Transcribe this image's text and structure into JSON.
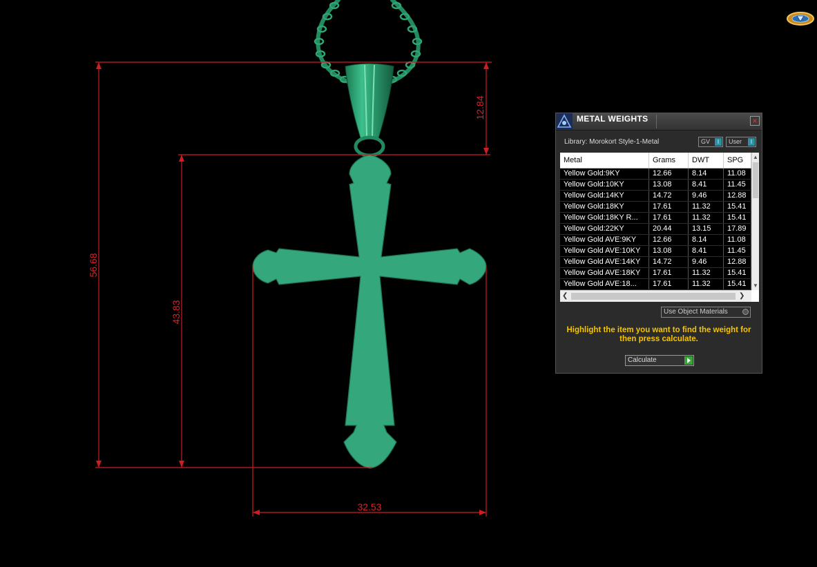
{
  "dimensions": {
    "overall_height": "56.68",
    "cross_height": "43.83",
    "bail_height": "12.84",
    "cross_width": "32.53"
  },
  "colors": {
    "metal_green": "#34a77c",
    "dimension_red": "#e0202a",
    "hint_yellow": "#f5c400"
  },
  "panel": {
    "title": "METAL WEIGHTS",
    "close_label": "×",
    "library_label": "Library: Morokort Style-1-Metal",
    "gv_label": "GV",
    "gv_indicator": "I",
    "user_label": "User",
    "user_indicator": "I",
    "table": {
      "headers": [
        "Metal",
        "Grams",
        "DWT",
        "SPG"
      ],
      "rows": [
        [
          "Yellow Gold:9KY",
          "12.66",
          "8.14",
          "11.08"
        ],
        [
          "Yellow Gold:10KY",
          "13.08",
          "8.41",
          "11.45"
        ],
        [
          "Yellow Gold:14KY",
          "14.72",
          "9.46",
          "12.88"
        ],
        [
          "Yellow Gold:18KY",
          "17.61",
          "11.32",
          "15.41"
        ],
        [
          "Yellow Gold:18KY R...",
          "17.61",
          "11.32",
          "15.41"
        ],
        [
          "Yellow Gold:22KY",
          "20.44",
          "13.15",
          "17.89"
        ],
        [
          "Yellow Gold AVE:9KY",
          "12.66",
          "8.14",
          "11.08"
        ],
        [
          "Yellow Gold AVE:10KY",
          "13.08",
          "8.41",
          "11.45"
        ],
        [
          "Yellow Gold AVE:14KY",
          "14.72",
          "9.46",
          "12.88"
        ],
        [
          "Yellow Gold AVE:18KY",
          "17.61",
          "11.32",
          "15.41"
        ],
        [
          "Yellow Gold AVE:18...",
          "17.61",
          "11.32",
          "15.41"
        ]
      ]
    },
    "use_object_materials_label": "Use Object Materials",
    "hint": "Highlight the item you want to find the weight for then press calculate.",
    "calculate_label": "Calculate"
  }
}
